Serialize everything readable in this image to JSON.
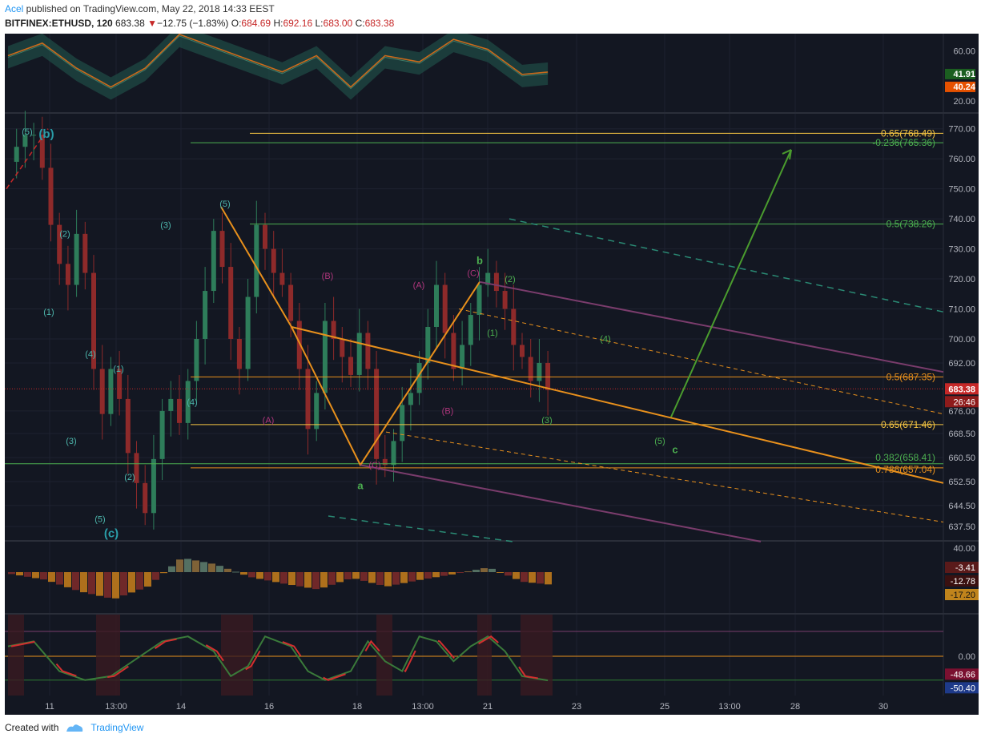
{
  "header": {
    "author": "Acel",
    "published_text": " published on TradingView.com, May 22, 2018 14:33 EEST",
    "symbol": "BITFINEX:ETHUSD, 120",
    "last": "683.38",
    "change": "−12.75 (−1.83%)",
    "o_label": "O:",
    "o_val": "684.69",
    "h_label": "H:",
    "h_val": "692.16",
    "l_label": "L:",
    "l_val": "683.00",
    "c_label": "C:",
    "c_val": "683.38"
  },
  "footer": {
    "created_with": "Created with",
    "brand": "TradingView"
  },
  "colors": {
    "bg": "#131722",
    "grid": "#1e2230",
    "axis_text": "#b2b5be",
    "bull": "#26a69a",
    "bear": "#c62828",
    "orange": "#e8901c",
    "green": "#4caf50",
    "teal_label": "#2a9da8",
    "magenta": "#b0367d",
    "yellow": "#f5c542",
    "purple": "#7a3c6c"
  },
  "price_axis": {
    "ticks": [
      "770.00",
      "760.00",
      "750.00",
      "740.00",
      "730.00",
      "720.00",
      "710.00",
      "700.00",
      "692.00",
      "676.00",
      "668.50",
      "660.50",
      "652.50",
      "644.50",
      "637.50"
    ],
    "current_price": "683.38",
    "countdown": "26:46"
  },
  "time_axis": [
    "11",
    "13:00",
    "14",
    "16",
    "18",
    "13:00",
    "21",
    "23",
    "25",
    "13:00",
    "28",
    "30"
  ],
  "rsi_panel": {
    "ticks": [
      "60.00",
      "20.00"
    ],
    "badge1": "41.91",
    "badge2": "40.24"
  },
  "macd_panel": {
    "tick": "40.00",
    "badges": [
      "-3.41",
      "-12.78",
      "-17.20"
    ]
  },
  "stoch_panel": {
    "tick": "0.00",
    "badges": [
      "-48.66",
      "-50.40"
    ]
  },
  "fib_labels": [
    {
      "text": "0.65(768.49)",
      "price": 768.49,
      "color": "#f5c542"
    },
    {
      "text": "-0.236(765.36)",
      "price": 765.36,
      "color": "#4caf50"
    },
    {
      "text": "0.5(738.26)",
      "price": 738.26,
      "color": "#4caf50"
    },
    {
      "text": "0.5(687.35)",
      "price": 687.35,
      "color": "#e8901c"
    },
    {
      "text": "0.65(671.46)",
      "price": 671.46,
      "color": "#f5c542"
    },
    {
      "text": "0.382(658.41)",
      "price": 658.41,
      "color": "#4caf50"
    },
    {
      "text": "0.786(657.04)",
      "price": 657.04,
      "color": "#e8901c"
    }
  ],
  "wave_labels": [
    {
      "text": "(5)",
      "x": 34,
      "price": 768,
      "color": "#4db6ac",
      "size": 11
    },
    {
      "text": "(b)",
      "x": 58,
      "price": 767,
      "color": "#2a9da8",
      "size": 15,
      "bold": true
    },
    {
      "text": "(2)",
      "x": 81,
      "price": 734,
      "color": "#4db6ac",
      "size": 11
    },
    {
      "text": "(1)",
      "x": 61,
      "price": 708,
      "color": "#4db6ac",
      "size": 11
    },
    {
      "text": "(4)",
      "x": 113,
      "price": 694,
      "color": "#4db6ac",
      "size": 11
    },
    {
      "text": "(1)",
      "x": 148,
      "price": 689,
      "color": "#4db6ac",
      "size": 11
    },
    {
      "text": "(3)",
      "x": 89,
      "price": 665,
      "color": "#4db6ac",
      "size": 11
    },
    {
      "text": "(2)",
      "x": 162,
      "price": 653,
      "color": "#4db6ac",
      "size": 11
    },
    {
      "text": "(5)",
      "x": 125,
      "price": 639,
      "color": "#4db6ac",
      "size": 11
    },
    {
      "text": "(c)",
      "x": 139,
      "price": 634,
      "color": "#2a9da8",
      "size": 15,
      "bold": true
    },
    {
      "text": "(3)",
      "x": 207,
      "price": 737,
      "color": "#4db6ac",
      "size": 11
    },
    {
      "text": "(4)",
      "x": 240,
      "price": 678,
      "color": "#4db6ac",
      "size": 11
    },
    {
      "text": "(5)",
      "x": 281,
      "price": 744,
      "color": "#4db6ac",
      "size": 11
    },
    {
      "text": "(B)",
      "x": 409,
      "price": 720,
      "color": "#b0367d",
      "size": 11
    },
    {
      "text": "(A)",
      "x": 335,
      "price": 672,
      "color": "#b0367d",
      "size": 11
    },
    {
      "text": "(C)",
      "x": 468,
      "price": 657,
      "color": "#b0367d",
      "size": 11
    },
    {
      "text": "a",
      "x": 450,
      "price": 650,
      "color": "#4caf50",
      "size": 13,
      "bold": true
    },
    {
      "text": "(A)",
      "x": 523,
      "price": 717,
      "color": "#b0367d",
      "size": 11
    },
    {
      "text": "(B)",
      "x": 559,
      "price": 675,
      "color": "#b0367d",
      "size": 11
    },
    {
      "text": "(C)",
      "x": 591,
      "price": 721,
      "color": "#b0367d",
      "size": 11
    },
    {
      "text": "b",
      "x": 599,
      "price": 725,
      "color": "#4caf50",
      "size": 13,
      "bold": true
    },
    {
      "text": "(2)",
      "x": 637,
      "price": 719,
      "color": "#4caf50",
      "size": 11
    },
    {
      "text": "(1)",
      "x": 615,
      "price": 701,
      "color": "#4caf50",
      "size": 11
    },
    {
      "text": "(4)",
      "x": 756,
      "price": 699,
      "color": "#4caf50",
      "size": 11
    },
    {
      "text": "(3)",
      "x": 683,
      "price": 672,
      "color": "#4caf50",
      "size": 11
    },
    {
      "text": "(5)",
      "x": 824,
      "price": 665,
      "color": "#4caf50",
      "size": 11
    },
    {
      "text": "c",
      "x": 843,
      "price": 662,
      "color": "#4caf50",
      "size": 13,
      "bold": true
    }
  ],
  "chart_data": {
    "type": "candlestick",
    "symbol": "BITFINEX:ETHUSD",
    "interval": "120",
    "ylim": [
      633,
      775
    ],
    "horizontal_levels": [
      768.49,
      765.36,
      738.26,
      687.35,
      683.38,
      671.46,
      658.41,
      657.04
    ],
    "price_path": [
      [
        0,
        759
      ],
      [
        1,
        764
      ],
      [
        2,
        768
      ],
      [
        3,
        768
      ],
      [
        4,
        757
      ],
      [
        5,
        738
      ],
      [
        6,
        725
      ],
      [
        7,
        718
      ],
      [
        8,
        735
      ],
      [
        9,
        722
      ],
      [
        10,
        690
      ],
      [
        11,
        675
      ],
      [
        12,
        690
      ],
      [
        13,
        680
      ],
      [
        14,
        662
      ],
      [
        15,
        652
      ],
      [
        16,
        642
      ],
      [
        17,
        660
      ],
      [
        18,
        676
      ],
      [
        19,
        680
      ],
      [
        20,
        672
      ],
      [
        21,
        686
      ],
      [
        22,
        700
      ],
      [
        23,
        716
      ],
      [
        24,
        736
      ],
      [
        25,
        724
      ],
      [
        26,
        700
      ],
      [
        27,
        690
      ],
      [
        28,
        714
      ],
      [
        29,
        738
      ],
      [
        30,
        730
      ],
      [
        31,
        722
      ],
      [
        32,
        718
      ],
      [
        33,
        706
      ],
      [
        34,
        690
      ],
      [
        35,
        670
      ],
      [
        36,
        682
      ],
      [
        37,
        706
      ],
      [
        38,
        700
      ],
      [
        39,
        694
      ],
      [
        40,
        688
      ],
      [
        41,
        702
      ],
      [
        42,
        690
      ],
      [
        43,
        660
      ],
      [
        44,
        658
      ],
      [
        45,
        666
      ],
      [
        46,
        678
      ],
      [
        47,
        682
      ],
      [
        48,
        692
      ],
      [
        49,
        704
      ],
      [
        50,
        718
      ],
      [
        51,
        702
      ],
      [
        52,
        690
      ],
      [
        53,
        698
      ],
      [
        54,
        708
      ],
      [
        55,
        718
      ],
      [
        56,
        722
      ],
      [
        57,
        716
      ],
      [
        58,
        710
      ],
      [
        59,
        698
      ],
      [
        60,
        694
      ],
      [
        61,
        686
      ],
      [
        62,
        692
      ],
      [
        63,
        683
      ]
    ],
    "rsi_path": [
      [
        0,
        55
      ],
      [
        4,
        65
      ],
      [
        8,
        45
      ],
      [
        12,
        30
      ],
      [
        16,
        45
      ],
      [
        20,
        72
      ],
      [
        24,
        62
      ],
      [
        28,
        52
      ],
      [
        32,
        42
      ],
      [
        36,
        55
      ],
      [
        40,
        30
      ],
      [
        44,
        55
      ],
      [
        48,
        50
      ],
      [
        52,
        68
      ],
      [
        56,
        60
      ],
      [
        60,
        40
      ],
      [
        63,
        41.91
      ]
    ],
    "macd_hist": [
      [
        0,
        -2
      ],
      [
        4,
        -8
      ],
      [
        8,
        -20
      ],
      [
        12,
        -28
      ],
      [
        16,
        -15
      ],
      [
        20,
        15
      ],
      [
        24,
        8
      ],
      [
        28,
        -5
      ],
      [
        32,
        -12
      ],
      [
        36,
        -18
      ],
      [
        40,
        -6
      ],
      [
        44,
        -15
      ],
      [
        48,
        -8
      ],
      [
        52,
        -2
      ],
      [
        56,
        5
      ],
      [
        60,
        -10
      ],
      [
        63,
        -12.78
      ]
    ],
    "stoch_path": [
      [
        0,
        20
      ],
      [
        3,
        30
      ],
      [
        6,
        -30
      ],
      [
        9,
        -48
      ],
      [
        12,
        -40
      ],
      [
        15,
        -5
      ],
      [
        18,
        30
      ],
      [
        21,
        40
      ],
      [
        24,
        10
      ],
      [
        26,
        -40
      ],
      [
        28,
        -20
      ],
      [
        30,
        40
      ],
      [
        33,
        20
      ],
      [
        35,
        -30
      ],
      [
        37,
        -48
      ],
      [
        40,
        -30
      ],
      [
        42,
        30
      ],
      [
        44,
        -10
      ],
      [
        46,
        -30
      ],
      [
        48,
        40
      ],
      [
        50,
        30
      ],
      [
        52,
        -10
      ],
      [
        54,
        20
      ],
      [
        56,
        40
      ],
      [
        58,
        10
      ],
      [
        60,
        -40
      ],
      [
        63,
        -48.66
      ]
    ]
  }
}
